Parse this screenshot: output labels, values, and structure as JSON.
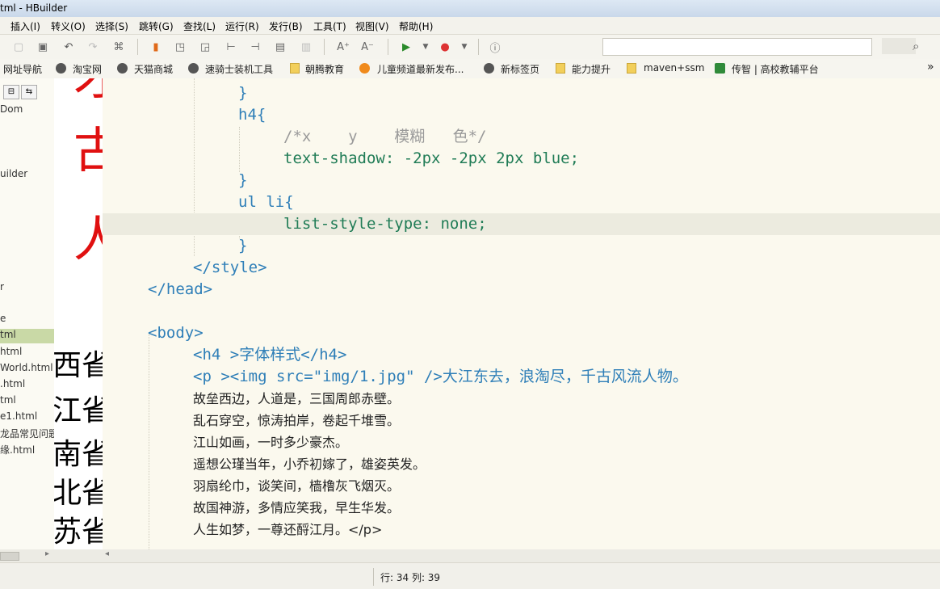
{
  "window": {
    "title": "tml - HBuilder"
  },
  "menu": [
    "插入(I)",
    "转义(O)",
    "选择(S)",
    "跳转(G)",
    "查找(L)",
    "运行(R)",
    "发行(B)",
    "工具(T)",
    "视图(V)",
    "帮助(H)"
  ],
  "bookmarks": [
    "网址导航",
    "淘宝网",
    "天猫商城",
    "速骑士装机工具",
    "朝腾教育",
    "儿童频道最新发布...",
    "新标签页",
    "能力提升",
    "maven+ssm",
    "传智 | 高校教辅平台"
  ],
  "bookmarks_more": "»",
  "left_panel": {
    "items": [
      "Dom",
      "uilder",
      "r",
      "e",
      "tml",
      "html",
      "World.html",
      ".html",
      "tml",
      "e1.html",
      "龙品常见问题",
      "缘.html"
    ]
  },
  "preview": {
    "red_glyphs": [
      "才",
      "古",
      "人"
    ],
    "black_glyphs": [
      "西省",
      "江省",
      "南省",
      "北省",
      "苏省"
    ]
  },
  "editor": {
    "lines": [
      "}",
      "h4{",
      "/*x    y    模糊   色*/",
      "text-shadow: -2px -2px 2px blue;",
      "}",
      "ul li{",
      "list-style-type: none;",
      "}",
      "</style>",
      "</head>",
      "",
      "<body>",
      "<h4 >字体样式</h4>",
      "<p ><img src=\"img/1.jpg\" />大江东去，浪淘尽，千古风流人物。",
      "故垒西边，人道是，三国周郎赤壁。",
      "乱石穿空，惊涛拍岸，卷起千堆雪。",
      "江山如画，一时多少豪杰。",
      "遥想公瑾当年，小乔初嫁了，雄姿英发。",
      "羽扇纶巾，谈笑间，樯橹灰飞烟灭。",
      "故国神游，多情应笑我，早生华发。",
      "人生如梦，一尊还酹江月。</p>"
    ]
  },
  "status": {
    "cursor": "行: 34 列: 39"
  },
  "colors": {
    "tag": "#2f7fb8",
    "property": "#207c56",
    "number": "#9c4cc6",
    "keyword": "#ef7a20"
  }
}
